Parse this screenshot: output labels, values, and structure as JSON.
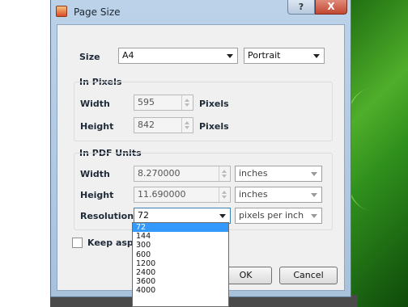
{
  "window": {
    "title": "Page Size",
    "help_label": "?",
    "close_label": "X"
  },
  "size": {
    "label": "Size",
    "value": "A4",
    "orientation": "Portrait"
  },
  "pixels": {
    "group_label": "In Pixels",
    "width_label": "Width",
    "width_value": "595",
    "width_unit": "Pixels",
    "height_label": "Height",
    "height_value": "842",
    "height_unit": "Pixels"
  },
  "pdf": {
    "group_label": "In PDF Units",
    "width_label": "Width",
    "width_value": "8.270000",
    "width_unit": "inches",
    "height_label": "Height",
    "height_value": "11.690000",
    "height_unit": "inches",
    "resolution_label": "Resolution",
    "resolution_value": "72",
    "resolution_unit": "pixels per inch"
  },
  "keep_aspect": {
    "label": "Keep aspe",
    "checked": false
  },
  "buttons": {
    "ok": "OK",
    "cancel": "Cancel"
  },
  "resolution_options": [
    "72",
    "144",
    "300",
    "600",
    "1200",
    "2400",
    "3600",
    "4000"
  ],
  "resolution_selected_index": 0
}
